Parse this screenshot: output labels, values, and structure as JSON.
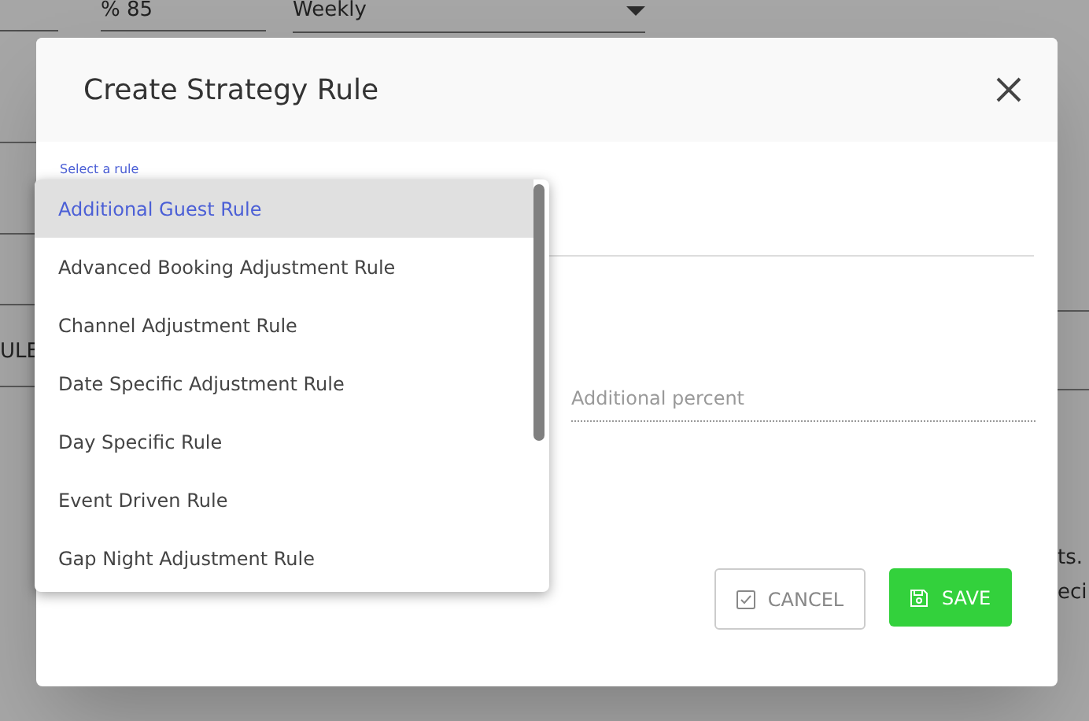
{
  "background": {
    "percent_field": {
      "value": "% 85"
    },
    "period_select": {
      "value": "Weekly"
    },
    "row_label": "ULE",
    "text_line_1": "ts.",
    "text_line_2": "eci"
  },
  "dialog": {
    "title": "Create Strategy Rule",
    "rule_select": {
      "label": "Select a rule",
      "options": [
        {
          "label": "Additional Guest Rule",
          "selected": true
        },
        {
          "label": "Advanced Booking Adjustment Rule",
          "selected": false
        },
        {
          "label": "Channel Adjustment Rule",
          "selected": false
        },
        {
          "label": "Date Specific Adjustment Rule",
          "selected": false
        },
        {
          "label": "Day Specific Rule",
          "selected": false
        },
        {
          "label": "Event Driven Rule",
          "selected": false
        },
        {
          "label": "Gap Night Adjustment Rule",
          "selected": false
        }
      ]
    },
    "percent_field": {
      "placeholder": "Additional percent"
    },
    "buttons": [
      {
        "kind": "cancel",
        "label": "CANCEL"
      },
      {
        "kind": "save",
        "label": "SAVE"
      }
    ]
  }
}
